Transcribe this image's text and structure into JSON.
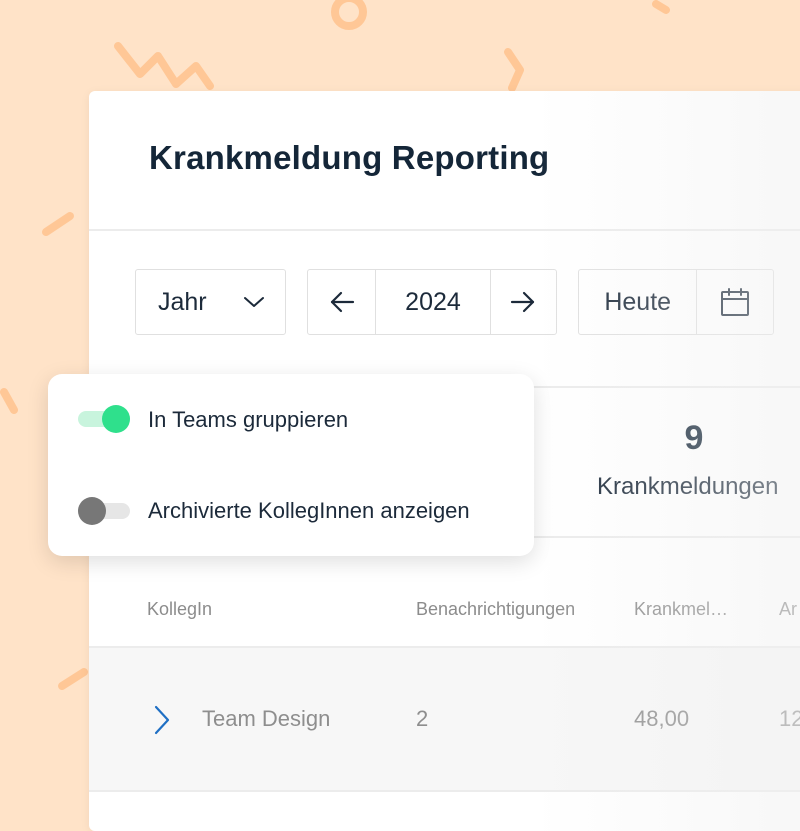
{
  "colors": {
    "background": "#ffe3c8",
    "decoration": "#ffc796",
    "toggle_on": "#2fe08c",
    "toggle_off": "#777777",
    "chevron": "#1f6fc4"
  },
  "header": {
    "title": "Krankmeldung Reporting"
  },
  "filters": {
    "period": {
      "value": "Jahr",
      "icon": "chevron-down-icon"
    },
    "year_nav": {
      "prev_icon": "arrow-left-icon",
      "year": "2024",
      "next_icon": "arrow-right-icon"
    },
    "today": {
      "label": "Heute",
      "icon": "calendar-icon"
    }
  },
  "options": {
    "group_teams": {
      "label": "In Teams gruppieren",
      "enabled": true
    },
    "show_archived": {
      "label": "Archivierte KollegInnen anzeigen",
      "enabled": false
    }
  },
  "stats": {
    "count": "9",
    "label": "Krankmeldungen"
  },
  "table": {
    "columns": [
      "KollegIn",
      "Benachrichtigungen",
      "Krankmel…",
      "Ar"
    ],
    "rows": [
      {
        "name": "Team Design",
        "notifications": "2",
        "sick_days": "48,00",
        "other": "12"
      }
    ]
  }
}
